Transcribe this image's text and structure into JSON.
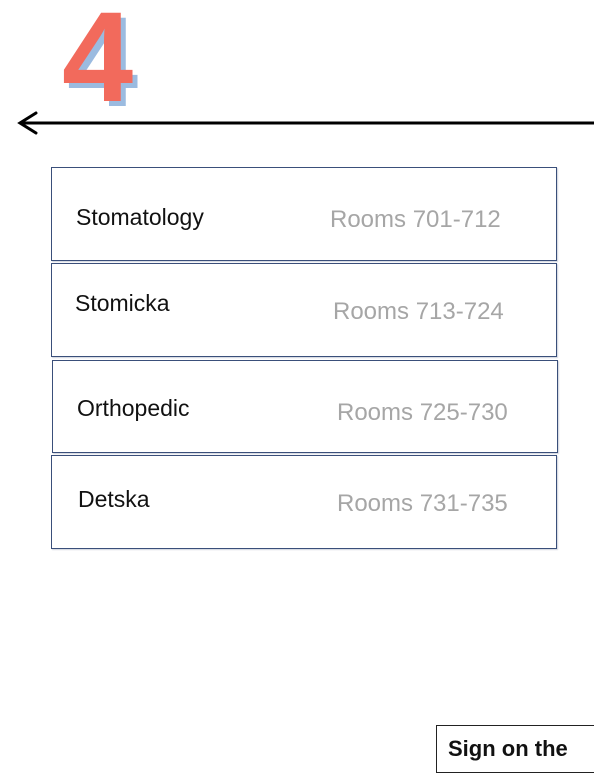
{
  "floor": {
    "number": "4",
    "number_color": "#f26a5c",
    "number_shadow_color": "#9bbbe0"
  },
  "direction_arrow": {
    "direction": "left",
    "icon": "arrow-left-icon"
  },
  "departments": [
    {
      "name": "Stomatology",
      "rooms": "Rooms 701-712"
    },
    {
      "name": "Stomicka",
      "rooms": "Rooms 713-724"
    },
    {
      "name": "Orthopedic",
      "rooms": "Rooms 725-730"
    },
    {
      "name": "Detska",
      "rooms": "Rooms 731-735"
    }
  ],
  "colors": {
    "box_border": "#3a4f7a",
    "rooms_text": "#a6a6a6"
  },
  "footer": {
    "sign_text": "Sign on the"
  }
}
